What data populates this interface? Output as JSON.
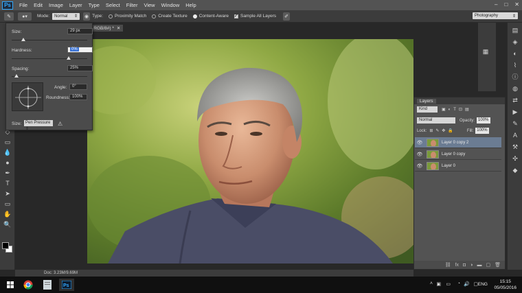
{
  "app": {
    "logo": "Ps"
  },
  "menu": [
    "File",
    "Edit",
    "Image",
    "Layer",
    "Type",
    "Select",
    "Filter",
    "View",
    "Window",
    "Help"
  ],
  "window_controls": [
    "–",
    "□",
    "✕"
  ],
  "options": {
    "mode_label": "Mode:",
    "mode_value": "Normal",
    "type_label": "Type:",
    "proximity": "Proximity Match",
    "create_texture": "Create Texture",
    "content_aware": "Content-Aware",
    "sample_all": "Sample All Layers",
    "workspace": "Photography"
  },
  "document": {
    "tab_title": "y 2, RGB/8#) *",
    "status": "Doc: 3.23M/9.69M"
  },
  "brush_popup": {
    "size_label": "Size:",
    "size_value": "29 px",
    "size_level_pct": 15,
    "hardness_label": "Hardness:",
    "hardness_value": "0%",
    "hardness_level_pct": 75,
    "spacing_label": "Spacing:",
    "spacing_value": "25%",
    "spacing_level_pct": 6,
    "angle_label": "Angle:",
    "angle_value": "0°",
    "roundness_label": "Roundness:",
    "roundness_value": "100%",
    "pressure_label": "Size:",
    "pressure_value": "Pen Pressure"
  },
  "layers_panel": {
    "tab": "Layers",
    "kind": "Kind",
    "blend": "Normal",
    "opacity_label": "Opacity:",
    "opacity_value": "100%",
    "lock_label": "Lock:",
    "fill_label": "Fill:",
    "fill_value": "100%",
    "layers": [
      {
        "name": "Layer 0 copy 2",
        "selected": true
      },
      {
        "name": "Layer 0 copy",
        "selected": false
      },
      {
        "name": "Layer 0",
        "selected": false
      }
    ]
  },
  "taskbar": {
    "lang": "ENG",
    "time": "15:15",
    "date": "05/05/2016"
  },
  "colors": {
    "accent": "#31a8ff",
    "selection": "#6b7c93"
  }
}
